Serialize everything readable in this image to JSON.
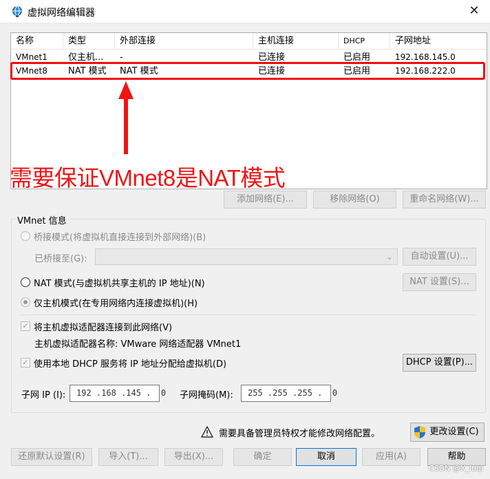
{
  "window": {
    "title": "虚拟网络编辑器",
    "close_glyph": "✕"
  },
  "network_table": {
    "columns": [
      "名称",
      "类型",
      "外部连接",
      "主机连接",
      "DHCP",
      "子网地址"
    ],
    "rows": [
      {
        "name": "VMnet1",
        "type": "仅主机...",
        "external": "-",
        "host": "已连接",
        "dhcp": "已启用",
        "subnet": "192.168.145.0"
      },
      {
        "name": "VMnet8",
        "type": "NAT 模式",
        "external": "NAT 模式",
        "host": "已连接",
        "dhcp": "已启用",
        "subnet": "192.168.222.0"
      }
    ]
  },
  "annotation": {
    "text": "需要保证VMnet8是NAT模式",
    "color": "#f01414"
  },
  "list_buttons": {
    "add": "添加网络(E)...",
    "remove": "移除网络(O)",
    "rename": "重命名网络(W)..."
  },
  "vmnet_info": {
    "title": "VMnet 信息",
    "bridged": "桥接模式(将虚拟机直接连接到外部网络)(B)",
    "bridged_to_label": "已桥接至(G):",
    "bridged_to_value": "",
    "auto_settings": "自动设置(U)...",
    "nat": "NAT 模式(与虚拟机共享主机的 IP 地址)(N)",
    "nat_settings": "NAT 设置(S)...",
    "host_only": "仅主机模式(在专用网络内连接虚拟机)(H)",
    "connect_adapter": "将主机虚拟适配器连接到此网络(V)",
    "adapter_name": "主机虚拟适配器名称: VMware 网络适配器 VMnet1",
    "use_dhcp": "使用本地 DHCP 服务将 IP 地址分配给虚拟机(D)",
    "dhcp_settings": "DHCP 设置(P)...",
    "subnet_ip_label": "子网 IP (I):",
    "subnet_ip_value": "192 .168 .145 .  0",
    "subnet_mask_label": "子网掩码(M):",
    "subnet_mask_value": "255 .255 .255 .  0"
  },
  "admin_notice": {
    "text": "需要具备管理员特权才能修改网络配置。",
    "change_settings": "更改设置(C)"
  },
  "footer": {
    "restore": "还原默认设置(R)",
    "import": "导入(T)...",
    "export": "导出(X)...",
    "ok": "确定",
    "cancel": "取消",
    "apply": "应用(A)",
    "help": "帮助"
  },
  "watermark": "CSDN @X_luqi"
}
